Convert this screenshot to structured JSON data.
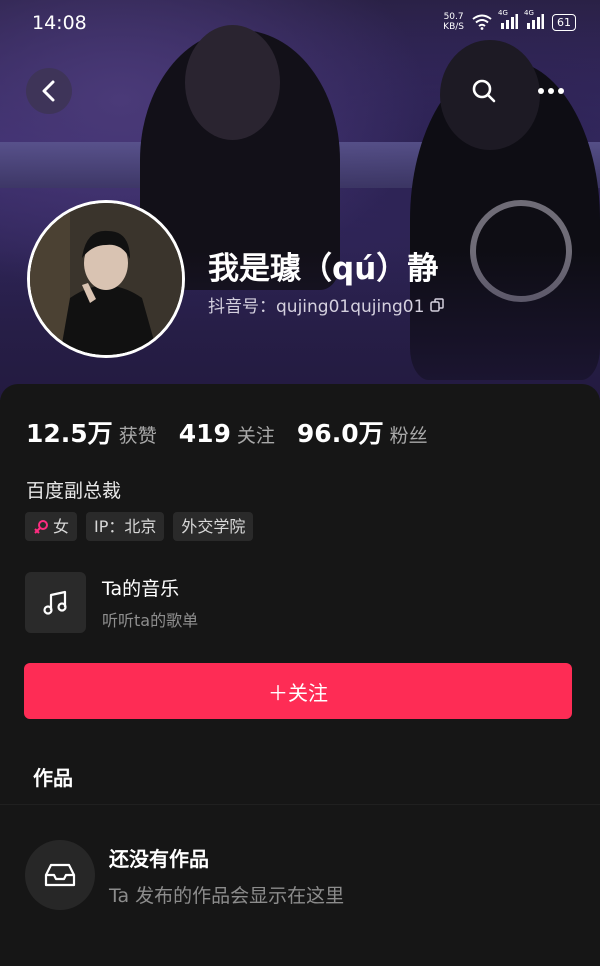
{
  "status_bar": {
    "time": "14:08",
    "net_speed_value": "50.7",
    "net_speed_unit": "KB/S",
    "signal1": "4G",
    "signal2": "4G",
    "battery": "61"
  },
  "profile": {
    "name": "我是璩（qú）静",
    "douyin_id": "抖音号：qujing01qujing01",
    "stats": [
      {
        "value": "12.5万",
        "label": "获赞"
      },
      {
        "value": "419",
        "label": "关注"
      },
      {
        "value": "96.0万",
        "label": "粉丝"
      }
    ],
    "bio": "百度副总裁",
    "tags": {
      "gender": "女",
      "gender_icon": "female-icon",
      "ip": "IP：北京",
      "school": "外交学院"
    }
  },
  "music": {
    "title": "Ta的音乐",
    "subtitle": "听听ta的歌单"
  },
  "follow_button": {
    "label": "＋关注",
    "color": "#fe2c55"
  },
  "works": {
    "title": "作品",
    "empty_title": "还没有作品",
    "empty_subtitle": "Ta 发布的作品会显示在这里"
  }
}
